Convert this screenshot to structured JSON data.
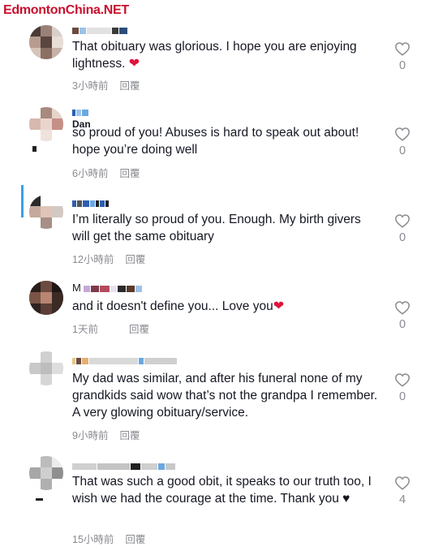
{
  "watermark": "EdmontonChina.NET",
  "comments": [
    {
      "username": "",
      "text": "That obituary was glorious. I hope you are enjoying lightness.",
      "text_suffix": "❤",
      "time": "3小時前",
      "reply": "回覆",
      "likes": "0"
    },
    {
      "username": "Dan",
      "text": "so proud of you! Abuses is hard to speak out about! hope you’re doing well",
      "text_suffix": "",
      "time": "6小時前",
      "reply": "回覆",
      "likes": "0"
    },
    {
      "username": "",
      "text": "I’m literally so proud of you. Enough. My birth givers will get the same obituary",
      "text_suffix": "",
      "time": "12小時前",
      "reply": "回覆",
      "likes": "0"
    },
    {
      "username": "M",
      "text": "and it doesn't define you... Love you",
      "text_suffix": "❤",
      "time": "1天前",
      "reply": "回覆",
      "likes": "0"
    },
    {
      "username": "",
      "text": "My dad was similar, and after his funeral none of my grandkids said wow that’s not the grandpa I remember. A very glowing obituary/service.",
      "text_suffix": "",
      "time": "9小時前",
      "reply": "回覆",
      "likes": "0"
    },
    {
      "username": "",
      "text": "That was such a good obit, it speaks to our truth too, I wish we had the courage at the time. Thank you",
      "text_suffix": "♥",
      "time": "15小時前",
      "reply": "回覆",
      "likes": "4"
    }
  ]
}
